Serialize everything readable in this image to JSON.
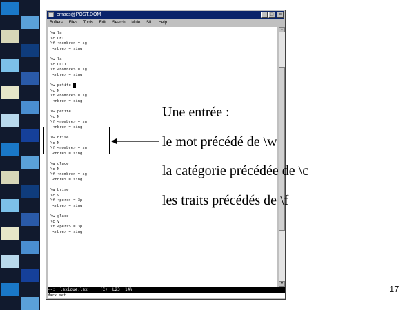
{
  "window": {
    "title": "emacs@POST.DOM",
    "menu": [
      "Buffers",
      "Files",
      "Tools",
      "Edit",
      "Search",
      "Mule",
      "SIL",
      "Help"
    ],
    "buttons": {
      "minimize": "_",
      "maximize": "□",
      "close": "×"
    }
  },
  "buffer": {
    "lines": [
      "\\w la",
      "\\c DET",
      "\\f <nombre> = sg",
      " <nbre> = sing",
      "",
      "\\w la",
      "\\c CLIT",
      "\\f <nombre> = sg",
      " <nbre> = sing",
      "",
      "\\w petite",
      "\\c N",
      "\\f <nombre> = sg",
      " <nbre> = sing",
      "",
      "\\w petite",
      "\\c N",
      "\\f <nombre> = sg",
      " <nbre> = sing",
      "",
      "\\w brise",
      "\\c N",
      "\\f <nombre> = sg",
      " <nbre> = sing",
      "",
      "\\w glace",
      "\\c N",
      "\\f <nombre> = sg",
      " <nbre> = sing",
      "",
      "\\w brise",
      "\\c V",
      "\\f <pers> = 3p",
      " <nbre> = sing",
      "",
      "\\w glace",
      "\\c V",
      "\\f <pers> = 3p",
      " <nbre> = sing"
    ],
    "mode_line": "--:  lexique.lex     (C)  L23  14%",
    "minibuffer": "Mark set"
  },
  "annotations": {
    "heading": "Une entrée :",
    "line1": "le mot précédé de \\w",
    "line2": "la catégorie précédée de \\c",
    "line3": "les traits précédés de \\f"
  },
  "slide": {
    "page_number": "17"
  },
  "colors": {
    "title_bar": "#0a246a",
    "mode_line": "#000000",
    "stripe_background": "#111a2e"
  }
}
